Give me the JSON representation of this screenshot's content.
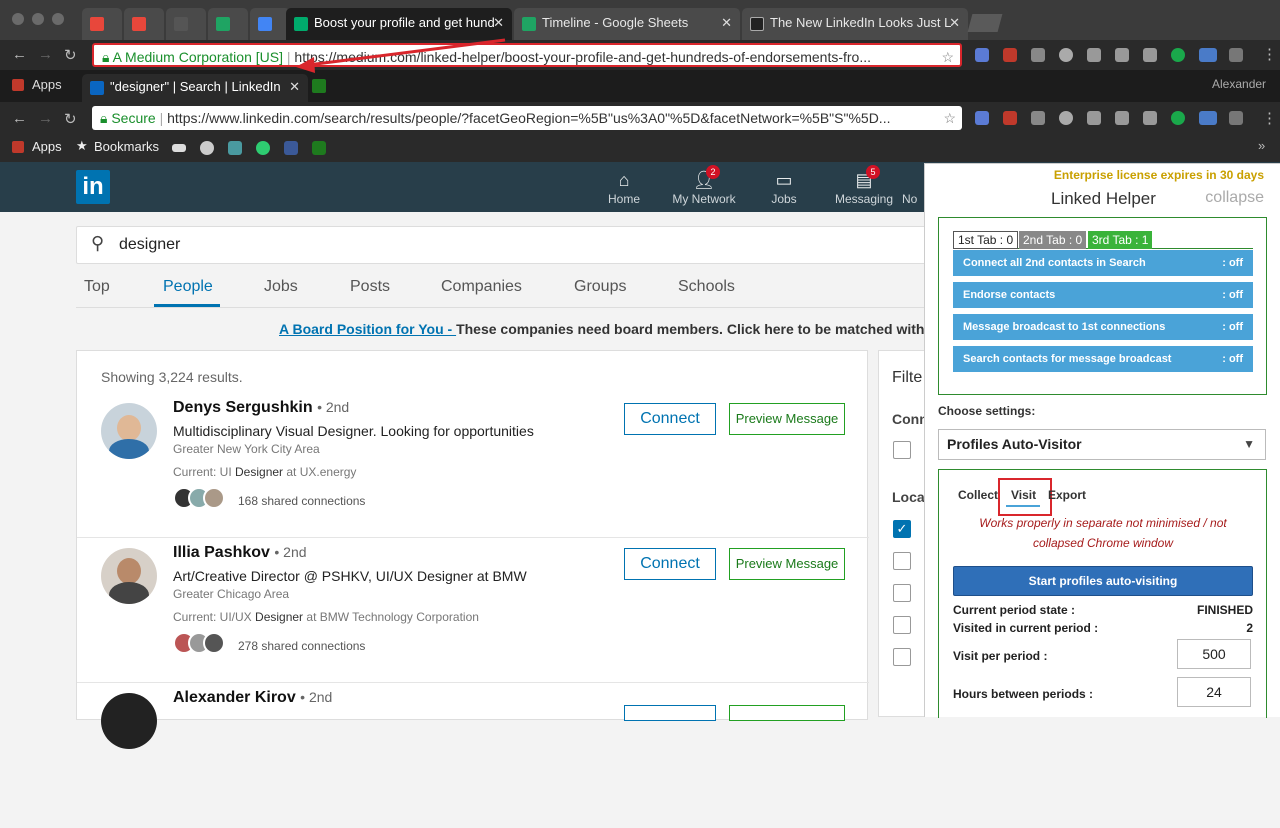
{
  "browser_back": {
    "tabs": [
      {
        "title": "",
        "icon": "gmail-icon"
      },
      {
        "title": "",
        "icon": "gmail-icon"
      },
      {
        "title": "",
        "icon": "doc-icon"
      },
      {
        "title": "",
        "icon": "sheets-icon"
      },
      {
        "title": "",
        "icon": "google-icon"
      },
      {
        "title": "Boost your profile and get hund",
        "icon": "medium-icon",
        "active": true
      },
      {
        "title": "Timeline - Google Sheets",
        "icon": "sheets-icon"
      },
      {
        "title": "The New LinkedIn Looks Just L",
        "icon": "ie-icon"
      }
    ],
    "address_secure_label": "A Medium Corporation [US]",
    "address_url": "https://medium.com/linked-helper/boost-your-profile-and-get-hundreds-of-endorsements-fro..."
  },
  "browser_front": {
    "apps_label": "Apps",
    "tab_title": "\"designer\" | Search | LinkedIn",
    "user_name": "Alexander",
    "address_secure_label": "Secure",
    "address_url": "https://www.linkedin.com/search/results/people/?facetGeoRegion=%5B\"us%3A0\"%5D&facetNetwork=%5B\"S\"%5D...",
    "bookmarks_label": "Bookmarks"
  },
  "linkedin": {
    "logo": "in",
    "nav": [
      {
        "label": "Home",
        "icon": "home-icon",
        "badge": ""
      },
      {
        "label": "My Network",
        "icon": "people-icon",
        "badge": "2"
      },
      {
        "label": "Jobs",
        "icon": "briefcase-icon",
        "badge": ""
      },
      {
        "label": "Messaging",
        "icon": "chat-icon",
        "badge": "5"
      },
      {
        "label": "No",
        "icon": "bell-icon",
        "badge": ""
      }
    ],
    "search_value": "designer",
    "subtabs": [
      "Top",
      "People",
      "Jobs",
      "Posts",
      "Companies",
      "Groups",
      "Schools"
    ],
    "active_subtab": "People",
    "ad_link": "A Board Position for You - ",
    "ad_text": "These companies need board members. Click here to be matched with",
    "results_count": "Showing 3,224 results.",
    "connect_label": "Connect",
    "preview_label": "Preview Message",
    "people": [
      {
        "name": "Denys Sergushkin",
        "degree": "• 2nd",
        "title": "Multidisciplinary Visual Designer. Looking for opportunities",
        "location": "Greater New York City Area",
        "current_pre": "Current: UI ",
        "current_hl": "Designer",
        "current_post": " at UX.energy",
        "shared": "168 shared connections"
      },
      {
        "name": "Illia Pashkov",
        "degree": "• 2nd",
        "title": "Art/Creative Director @ PSHKV, UI/UX Designer at BMW",
        "location": "Greater Chicago Area",
        "current_pre": "Current: UI/UX ",
        "current_hl": "Designer",
        "current_post": " at BMW Technology Corporation",
        "shared": "278 shared connections"
      },
      {
        "name": "Alexander Kirov",
        "degree": "• 2nd",
        "title": "",
        "location": "",
        "current_pre": "",
        "current_hl": "",
        "current_post": "",
        "shared": ""
      }
    ],
    "filters_heading": "Filte",
    "filter_conn": "Conn",
    "filter_loc": "Locat"
  },
  "linked_helper": {
    "license": "Enterprise license expires in 30 days",
    "title": "Linked Helper",
    "collapse": "collapse",
    "tabs": [
      {
        "label": "1st Tab : 0",
        "color": "#ffffff"
      },
      {
        "label": "2nd Tab : 0",
        "color": "#888888"
      },
      {
        "label": "3rd Tab : 1",
        "color": "#3ab33a"
      }
    ],
    "actions": [
      {
        "label": "Connect all 2nd contacts in Search",
        "state": ": off"
      },
      {
        "label": "Endorse contacts",
        "state": ": off"
      },
      {
        "label": "Message broadcast to 1st connections",
        "state": ": off"
      },
      {
        "label": "Search contacts for message broadcast",
        "state": ": off"
      }
    ],
    "choose_settings": "Choose settings:",
    "selected_setting": "Profiles Auto-Visitor",
    "subtabs": [
      "Collect",
      "Visit",
      "Export"
    ],
    "active_subtab": "Visit",
    "warning": "Works properly in separate not minimised / not collapsed Chrome window",
    "start_button": "Start profiles auto-visiting",
    "period_state_label": "Current period state :",
    "period_state_value": "FINISHED",
    "visited_label": "Visited in current period :",
    "visited_value": "2",
    "visit_per_period_label": "Visit per period :",
    "visit_per_period_value": "500",
    "hours_label": "Hours between periods :",
    "hours_value": "24"
  },
  "colors": {
    "linkedin_nav": "#283e4a",
    "linkedin_blue": "#0073b1",
    "lh_blue": "#4aa3d8",
    "lh_green": "#2e8b2e",
    "annotation_red": "#d9262c"
  }
}
